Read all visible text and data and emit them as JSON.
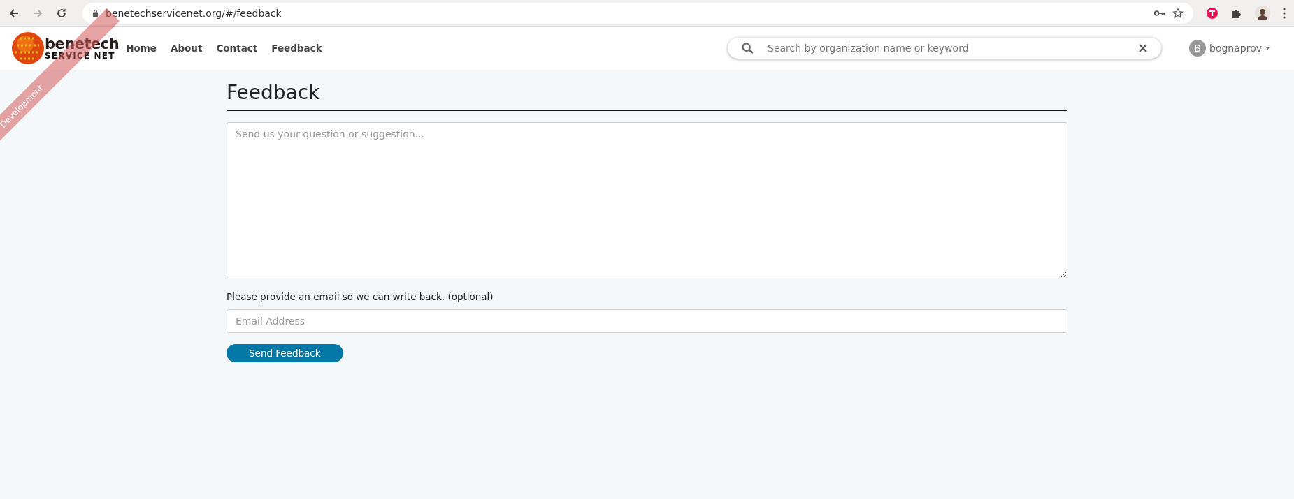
{
  "browser": {
    "url": "benetechservicenet.org/#/feedback",
    "back_disabled": false,
    "forward_disabled": true
  },
  "ribbon": {
    "label": "Development"
  },
  "logo": {
    "name": "benetech",
    "subtitle": "SERVICE NET"
  },
  "nav": [
    {
      "label": "Home"
    },
    {
      "label": "About"
    },
    {
      "label": "Contact"
    },
    {
      "label": "Feedback"
    }
  ],
  "search": {
    "placeholder": "Search by organization name or keyword"
  },
  "user": {
    "initial": "B",
    "name": "bognaprov"
  },
  "page": {
    "title": "Feedback",
    "message_placeholder": "Send us your question or suggestion...",
    "email_label": "Please provide an email so we can write back. (optional)",
    "email_placeholder": "Email Address",
    "submit": "Send Feedback"
  }
}
